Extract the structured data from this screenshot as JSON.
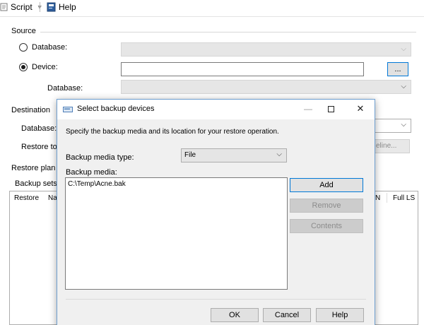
{
  "toolbar": {
    "script_label": "Script",
    "help_label": "Help"
  },
  "source": {
    "section_label": "Source",
    "database_radio_label": "Database:",
    "device_radio_label": "Device:",
    "selected": "Device",
    "database_label": "Database:",
    "browse_label": "..."
  },
  "destination": {
    "section_label": "Destination",
    "database_label": "Database:",
    "restore_to_label": "Restore to",
    "timeline_label": "eline..."
  },
  "restore_plan": {
    "section_label": "Restore plan",
    "backup_sets_label": "Backup sets",
    "columns": [
      "Restore",
      "Na",
      "N",
      "Full LS"
    ]
  },
  "dialog": {
    "title": "Select backup devices",
    "description": "Specify the backup media and its location for your restore operation.",
    "media_type_label": "Backup media type:",
    "media_type_value": "File",
    "media_label": "Backup media:",
    "media_items": [
      "C:\\Temp\\Acne.bak"
    ],
    "add_label": "Add",
    "remove_label": "Remove",
    "contents_label": "Contents",
    "ok_label": "OK",
    "cancel_label": "Cancel",
    "help_label": "Help"
  },
  "colors": {
    "accent": "#0078d7",
    "dialog_bg": "#f0f0f0",
    "disabled_combo": "#e6e6e6"
  }
}
